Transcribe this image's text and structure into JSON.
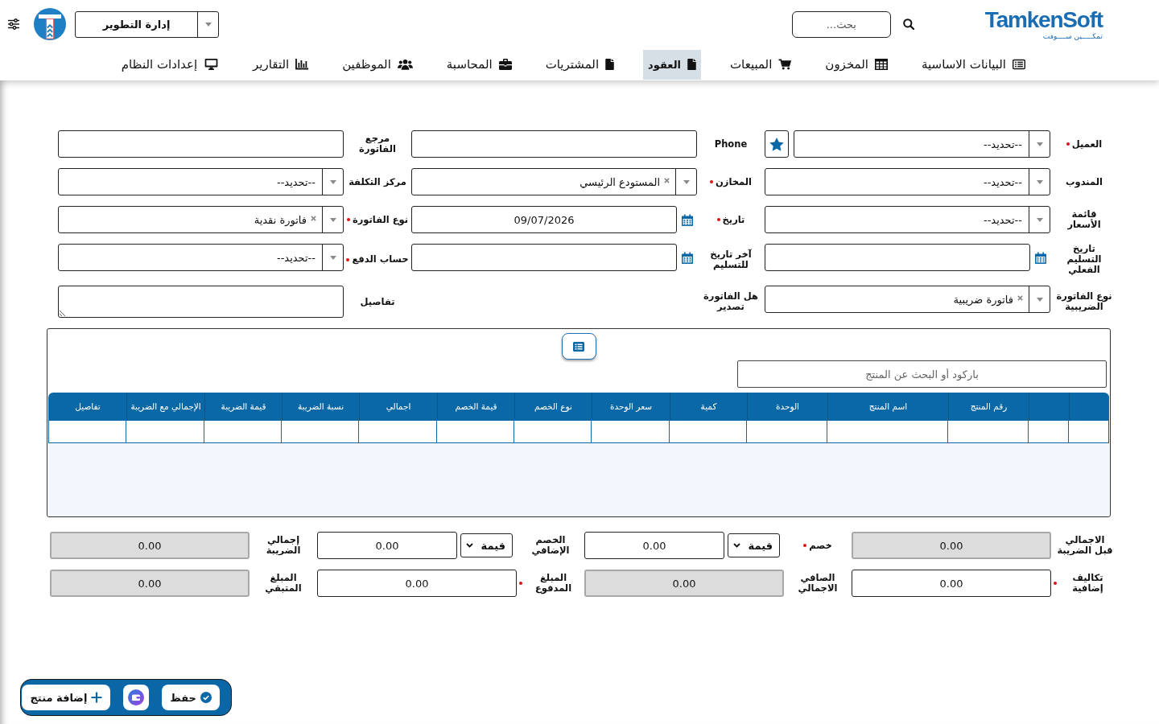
{
  "header": {
    "logo": {
      "wordmark": "TamkenSoft",
      "tagline": "تمكـــــين ســــوفت"
    },
    "search": {
      "placeholder": "بحث..."
    },
    "department": {
      "value": "إدارة التطوير"
    }
  },
  "nav": [
    {
      "label": "البيانات الاساسية",
      "selected": false
    },
    {
      "label": "المخزون",
      "selected": false
    },
    {
      "label": "المبيعات",
      "selected": false
    },
    {
      "label": "العقود",
      "selected": true
    },
    {
      "label": "المشتريات",
      "selected": false
    },
    {
      "label": "المحاسبة",
      "selected": false
    },
    {
      "label": "الموظفين",
      "selected": false
    },
    {
      "label": "التقارير",
      "selected": false
    },
    {
      "label": "إعدادات النظام",
      "selected": false
    }
  ],
  "form": {
    "fields": [
      {
        "label": "العميل",
        "required": true,
        "kind": "starred",
        "value": "--تحديد--"
      },
      {
        "label": "Phone",
        "required": false,
        "kind": "text"
      },
      {
        "label": "مرجع الفاتورة",
        "required": false,
        "kind": "text"
      },
      {
        "label": "المندوب",
        "required": false,
        "kind": "select",
        "value": "--تحديد--"
      },
      {
        "label": "المخازن",
        "required": true,
        "kind": "tag",
        "value": "المستودع الرئيسي"
      },
      {
        "label": "مركز التكلفة",
        "required": false,
        "kind": "select",
        "value": "--تحديد--"
      },
      {
        "label": "قائمة الأسعار",
        "required": false,
        "kind": "select",
        "value": "--تحديد--"
      },
      {
        "label": "تاريخ",
        "required": true,
        "kind": "date",
        "value": "09/07/2026"
      },
      {
        "label": "نوع الفاتورة",
        "required": true,
        "kind": "tag",
        "value": "فاتورة نقدية"
      },
      {
        "label": "تاريخ التسليم الفعلي",
        "required": false,
        "kind": "date"
      },
      {
        "label": "آخر تاريخ للتسليم",
        "required": false,
        "kind": "date"
      },
      {
        "label": "حساب الدفع",
        "required": true,
        "kind": "select",
        "value": "--تحديد--"
      },
      {
        "label": "نوع الفاتورة الضريبية",
        "required": false,
        "kind": "tag",
        "value": "فاتورة ضريبية"
      },
      {
        "label": "هل الفاتورة تصدير",
        "required": false,
        "kind": "blank"
      },
      {
        "label": "تفاصيل",
        "required": false,
        "kind": "textarea"
      }
    ]
  },
  "items": {
    "search": {
      "placeholder": "باركود أو البحث عن المنتج"
    },
    "columns": [
      "رقم المنتج",
      "اسم المنتج",
      "الوحدة",
      "كمية",
      "سعر الوحدة",
      "نوع الخصم",
      "قيمة الخصم",
      "اجمالي",
      "نسبة الضريبة",
      "قيمة الضريبة",
      "الإجمالي مع الضريبة",
      "تفاصيل"
    ]
  },
  "totals": [
    {
      "label": "الاجمالي قبل الضريبة",
      "required": false,
      "kind": "readonly",
      "value": "0.00"
    },
    {
      "label": "خصم",
      "required": true,
      "kind": "discount",
      "discount_type": "قيمة",
      "value": "0.00"
    },
    {
      "label": "الخصم الإضافي",
      "required": false,
      "kind": "discount",
      "discount_type": "قيمة",
      "value": "0.00"
    },
    {
      "label": "إجمالي الضريبة",
      "required": false,
      "kind": "readonly",
      "value": "0.00"
    },
    {
      "label": "تكاليف إضافية",
      "required": true,
      "kind": "input",
      "value": "0.00"
    },
    {
      "label": "الصافي الاجمالي",
      "required": false,
      "kind": "readonly",
      "value": "0.00"
    },
    {
      "label": "المبلغ المدفوع",
      "required": true,
      "kind": "input",
      "value": "0.00"
    },
    {
      "label": "المبلغ المتبقي",
      "required": false,
      "kind": "readonly",
      "value": "0.00"
    }
  ],
  "actions": [
    {
      "kind": "text",
      "label": "حفظ"
    },
    {
      "kind": "icon"
    },
    {
      "kind": "text",
      "label": "إضافة منتج"
    }
  ]
}
